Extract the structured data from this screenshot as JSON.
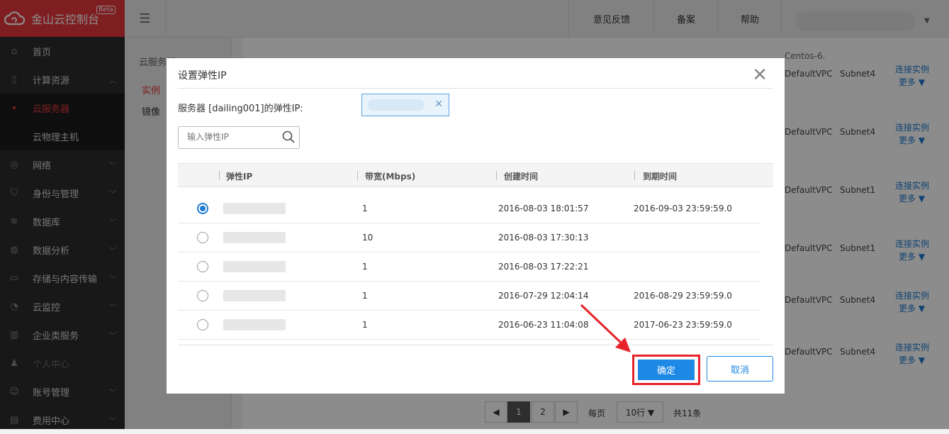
{
  "brand": {
    "title": "金山云控制台",
    "badge": "Beta",
    "color": "#e8383d"
  },
  "sidebar": {
    "items": [
      {
        "label": "首页",
        "icon": "home-icon",
        "glyph": "⌂"
      },
      {
        "label": "计算资源",
        "icon": "server-icon",
        "glyph": "▯",
        "chev": "︿"
      },
      {
        "label": "网络",
        "icon": "network-icon",
        "glyph": "◎",
        "chev": "﹀"
      },
      {
        "label": "身份与管理",
        "icon": "shield-icon",
        "glyph": "⛉",
        "chev": "﹀"
      },
      {
        "label": "数据库",
        "icon": "database-icon",
        "glyph": "≋",
        "chev": "﹀"
      },
      {
        "label": "数据分析",
        "icon": "analytics-icon",
        "glyph": "◍",
        "chev": "﹀"
      },
      {
        "label": "存储与内容传输",
        "icon": "storage-icon",
        "glyph": "▭",
        "chev": "﹀"
      },
      {
        "label": "云监控",
        "icon": "monitor-icon",
        "glyph": "◔",
        "chev": "﹀"
      },
      {
        "label": "企业类服务",
        "icon": "building-icon",
        "glyph": "▥",
        "chev": "﹀"
      },
      {
        "label": "个人中心",
        "icon": "user-icon",
        "glyph": "♟"
      },
      {
        "label": "账号管理",
        "icon": "account-icon",
        "glyph": "☺",
        "chev": "﹀"
      },
      {
        "label": "费用中心",
        "icon": "billing-icon",
        "glyph": "▤",
        "chev": "﹀"
      }
    ],
    "sub_items": [
      {
        "label": "云服务器"
      },
      {
        "label": "云物理主机"
      }
    ]
  },
  "topbar": {
    "feedback": "意见反馈",
    "record": "备案",
    "help": "帮助"
  },
  "subnav": {
    "title": "云服务器",
    "instance": "实例",
    "image": "镜像"
  },
  "background_table": {
    "top_os": "Centos-6.",
    "rows": [
      {
        "vpc": "DefaultVPC",
        "subnet": "Subnet4"
      },
      {
        "vpc": "DefaultVPC",
        "subnet": "Subnet4"
      },
      {
        "vpc": "DefaultVPC",
        "subnet": "Subnet1"
      },
      {
        "vpc": "DefaultVPC",
        "subnet": "Subnet1"
      },
      {
        "vpc": "DefaultVPC",
        "subnet": "Subnet4"
      },
      {
        "vpc": "DefaultVPC",
        "subnet": "Subnet4"
      }
    ],
    "connect_label": "连接实例",
    "more_label": "更多 ▼"
  },
  "pagination": {
    "prev": "◀",
    "next": "▶",
    "pages": [
      "1",
      "2"
    ],
    "current": "1",
    "per_page_label": "每页",
    "per_page_value": "10行 ▼",
    "total": "共11条"
  },
  "modal": {
    "title": "设置弹性IP",
    "close": "✕",
    "server_label": "服务器 [dailing001]的弹性IP:",
    "tag_remove": "✕",
    "search_placeholder": "输入弹性IP",
    "columns": [
      "弹性IP",
      "带宽(Mbps)",
      "创建时间",
      "到期时间"
    ],
    "rows": [
      {
        "selected": true,
        "bandwidth": "1",
        "created": "2016-08-03 18:01:57",
        "expires": "2016-09-03 23:59:59.0"
      },
      {
        "selected": false,
        "bandwidth": "10",
        "created": "2016-08-03 17:30:13",
        "expires": ""
      },
      {
        "selected": false,
        "bandwidth": "1",
        "created": "2016-08-03 17:22:21",
        "expires": ""
      },
      {
        "selected": false,
        "bandwidth": "1",
        "created": "2016-07-29 12:04:14",
        "expires": "2016-08-29 23:59:59.0"
      },
      {
        "selected": false,
        "bandwidth": "1",
        "created": "2016-06-23 11:04:08",
        "expires": "2017-06-23 23:59:59.0"
      }
    ],
    "confirm": "确定",
    "cancel": "取消",
    "highlight_color": "#e8222a",
    "primary_color": "#1e88e5"
  }
}
